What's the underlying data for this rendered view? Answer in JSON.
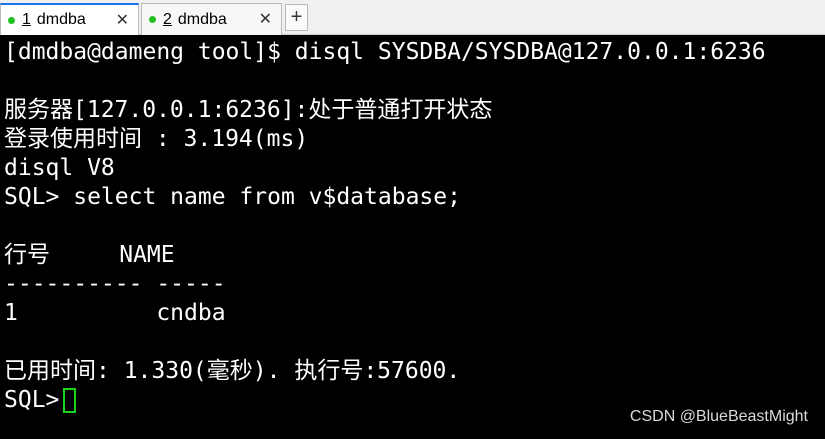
{
  "tabs": [
    {
      "number": "1",
      "label": "dmdba",
      "close": "✕",
      "active": true,
      "dot_color": "#1fbf1f"
    },
    {
      "number": "2",
      "label": "dmdba",
      "close": "✕",
      "active": false,
      "dot_color": "#1fbf1f"
    }
  ],
  "new_tab_label": "+",
  "terminal": {
    "lines": [
      "[dmdba@dameng tool]$ disql SYSDBA/SYSDBA@127.0.0.1:6236",
      "",
      "服务器[127.0.0.1:6236]:处于普通打开状态",
      "登录使用时间 : 3.194(ms)",
      "disql V8",
      "SQL> select name from v$database;",
      "",
      "行号     NAME",
      "---------- -----",
      "1          cndba",
      "",
      "已用时间: 1.330(毫秒). 执行号:57600."
    ],
    "prompt": "SQL>",
    "cursor_color": "#19d419"
  },
  "watermark": "CSDN @BlueBeastMight"
}
